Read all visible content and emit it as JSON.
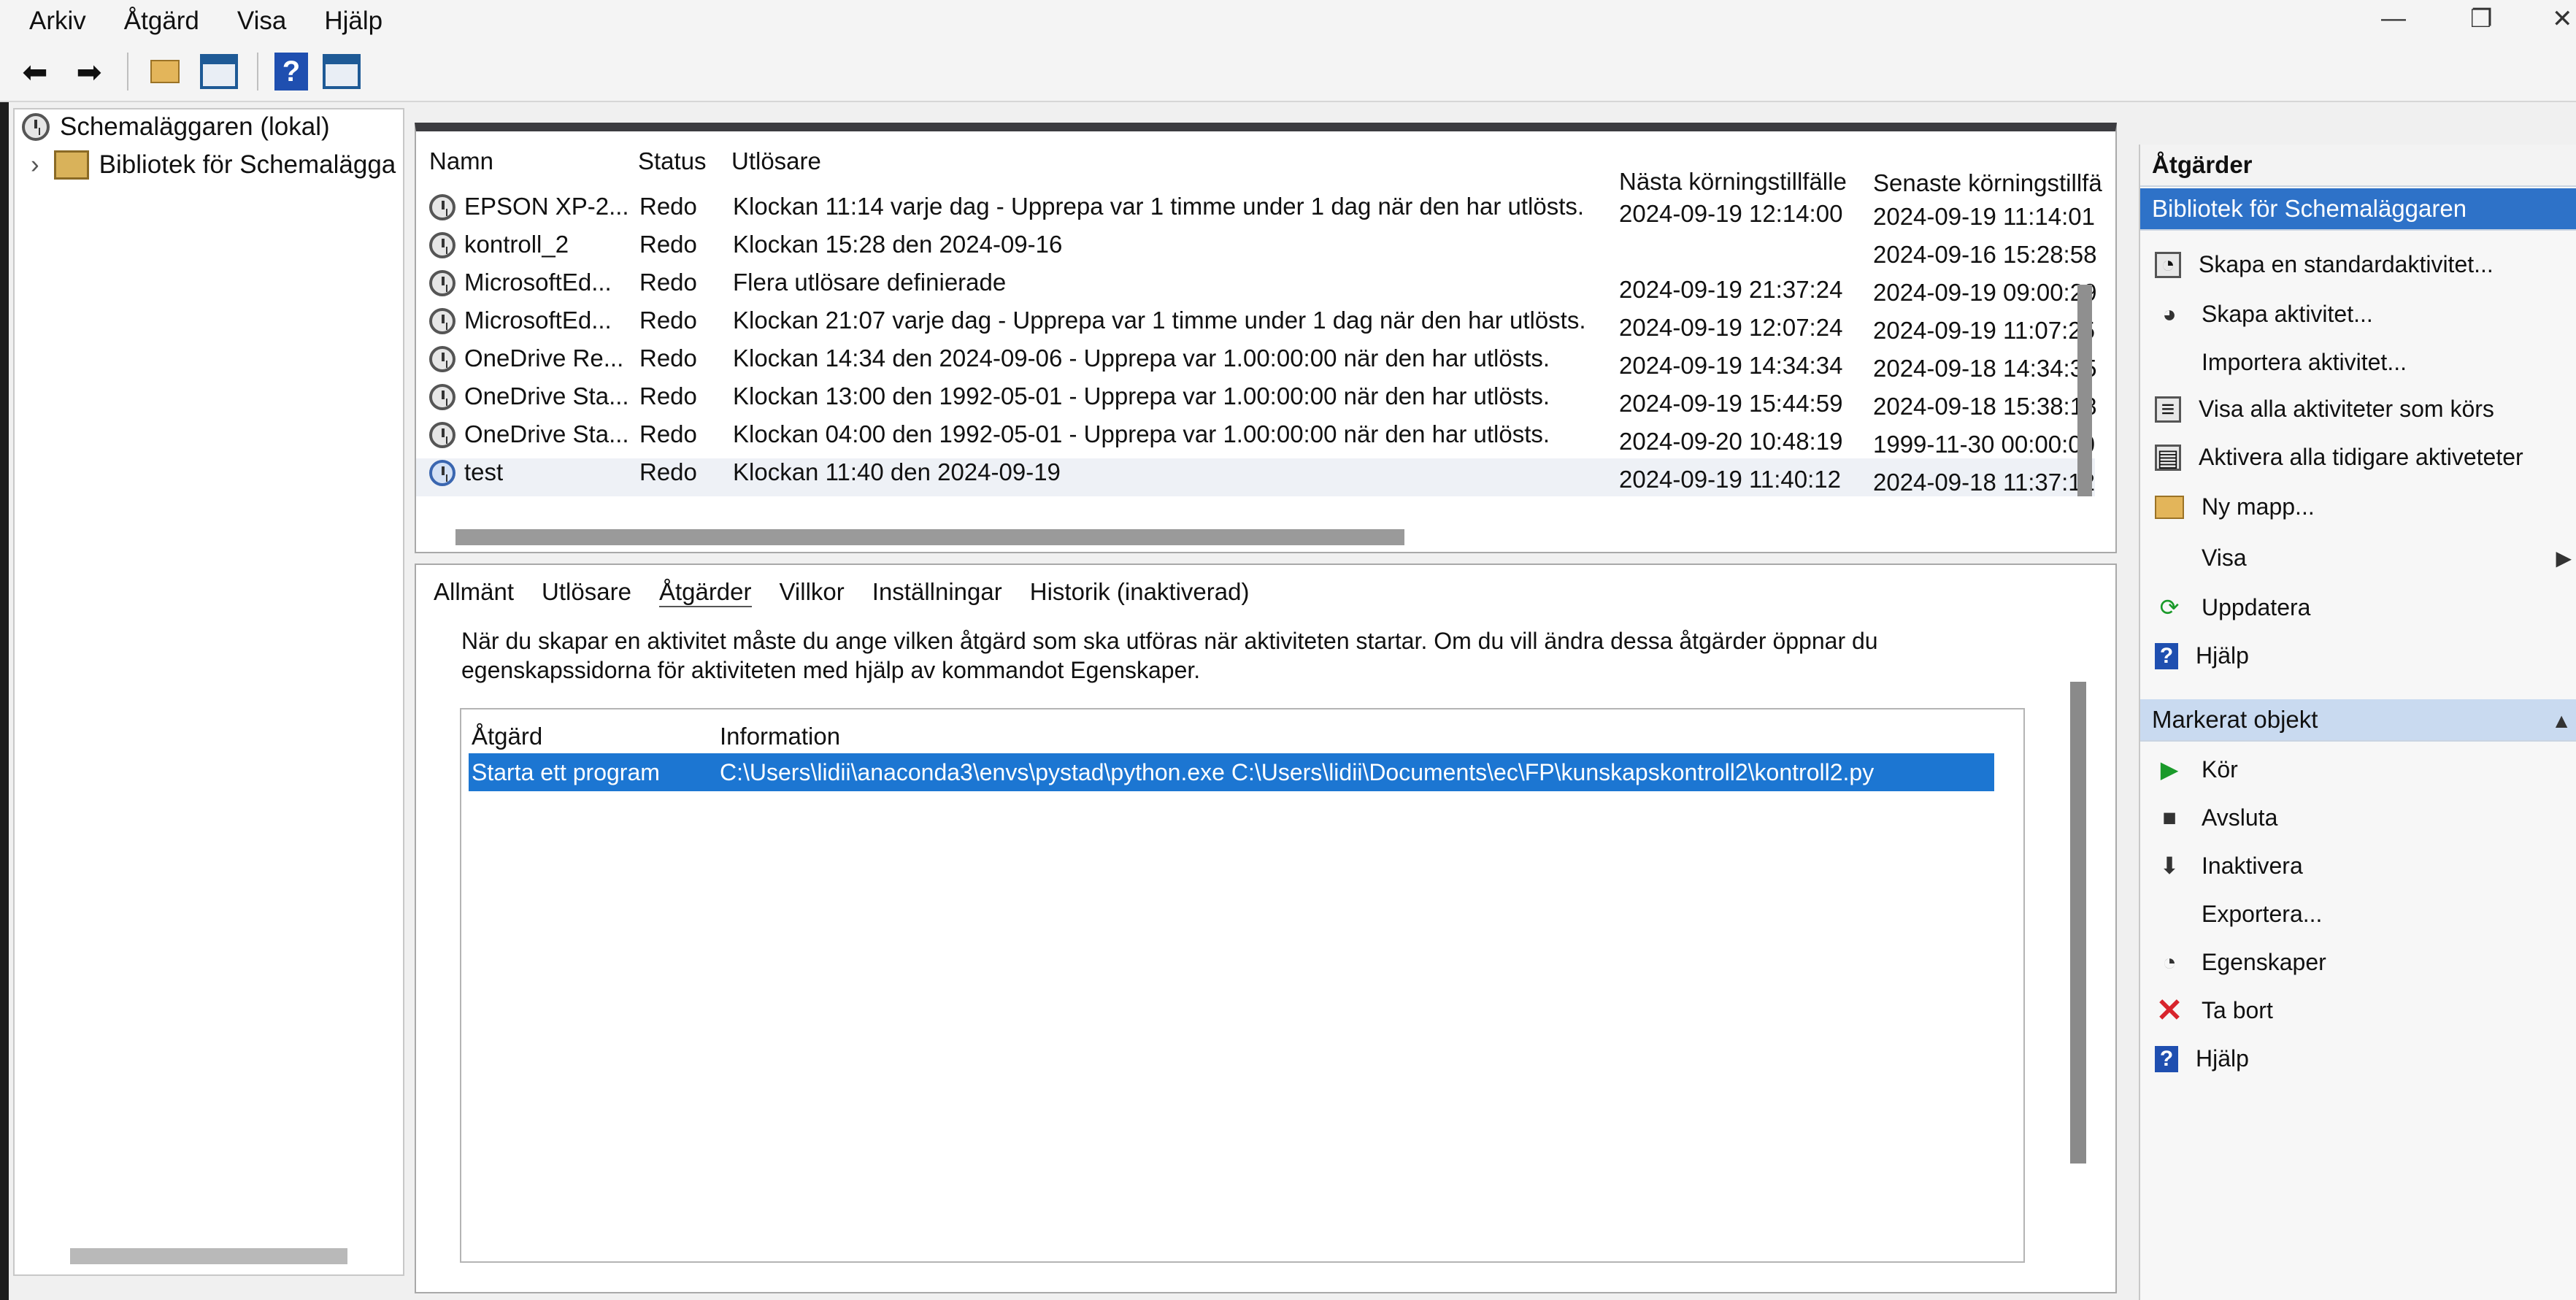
{
  "menu": [
    "Arkiv",
    "Åtgärd",
    "Visa",
    "Hjälp"
  ],
  "toolbar": {
    "back_icon": "arrow-left-icon",
    "forward_icon": "arrow-right-icon",
    "help_label": "?"
  },
  "tree": {
    "root": "Schemaläggaren (lokal)",
    "expander": "›",
    "child": "Bibliotek för Schemalägga"
  },
  "list": {
    "columns": [
      "Namn",
      "Status",
      "Utlösare",
      "Nästa körningstillfälle",
      "Senaste körningstillfä"
    ],
    "rows": [
      {
        "name": "EPSON XP-2...",
        "status": "Redo",
        "trigger": "Klockan 11:14 varje dag - Upprepa var 1 timme under 1 dag när den har utlösts.",
        "next": "2024-09-19 12:14:00",
        "last": "2024-09-19 11:14:01"
      },
      {
        "name": "kontroll_2",
        "status": "Redo",
        "trigger": "Klockan 15:28 den 2024-09-16",
        "next": "",
        "last": "2024-09-16 15:28:58"
      },
      {
        "name": "MicrosoftEd...",
        "status": "Redo",
        "trigger": "Flera utlösare definierade",
        "next": "2024-09-19 21:37:24",
        "last": "2024-09-19 09:00:29"
      },
      {
        "name": "MicrosoftEd...",
        "status": "Redo",
        "trigger": "Klockan 21:07 varje dag - Upprepa var 1 timme under 1 dag när den har utlösts.",
        "next": "2024-09-19 12:07:24",
        "last": "2024-09-19 11:07:25"
      },
      {
        "name": "OneDrive Re...",
        "status": "Redo",
        "trigger": "Klockan 14:34 den 2024-09-06 - Upprepa var 1.00:00:00 när den har utlösts.",
        "next": "2024-09-19 14:34:34",
        "last": "2024-09-18 14:34:35"
      },
      {
        "name": "OneDrive Sta...",
        "status": "Redo",
        "trigger": "Klockan 13:00 den 1992-05-01 - Upprepa var 1.00:00:00 när den har utlösts.",
        "next": "2024-09-19 15:44:59",
        "last": "2024-09-18 15:38:18"
      },
      {
        "name": "OneDrive Sta...",
        "status": "Redo",
        "trigger": "Klockan 04:00 den 1992-05-01 - Upprepa var 1.00:00:00 när den har utlösts.",
        "next": "2024-09-20 10:48:19",
        "last": "1999-11-30 00:00:00"
      },
      {
        "name": "test",
        "status": "Redo",
        "trigger": "Klockan 11:40 den 2024-09-19",
        "next": "2024-09-19 11:40:12",
        "last": "2024-09-18 11:37:12"
      }
    ]
  },
  "details": {
    "tabs": [
      "Allmänt",
      "Utlösare",
      "Åtgärder",
      "Villkor",
      "Inställningar",
      "Historik (inaktiverad)"
    ],
    "active_tab": "Åtgärder",
    "description": "När du skapar en aktivitet måste du ange vilken åtgärd som ska utföras när aktiviteten startar. Om du vill ändra dessa åtgärder öppnar du egenskapssidorna för aktiviteten med hjälp av kommandot Egenskaper.",
    "columns": [
      "Åtgärd",
      "Information"
    ],
    "row": {
      "action": "Starta ett program",
      "info": "C:\\Users\\lidii\\anaconda3\\envs\\pystad\\python.exe C:\\Users\\lidii\\Documents\\ec\\FP\\kunskapskontroll2\\kontroll2.py"
    }
  },
  "actions_pane": {
    "title": "Åtgärder",
    "section1": "Bibliotek för Schemaläggaren",
    "items1": [
      {
        "label": "Skapa en standardaktivitet...",
        "icon": "create-basic-task-icon"
      },
      {
        "label": "Skapa aktivitet...",
        "icon": "create-task-icon"
      },
      {
        "label": "Importera aktivitet...",
        "icon": ""
      },
      {
        "label": "Visa alla aktiviteter som körs",
        "icon": "running-tasks-icon"
      },
      {
        "label": "Aktivera alla tidigare aktiveteter",
        "icon": "history-icon"
      },
      {
        "label": "Ny mapp...",
        "icon": "folder-icon"
      },
      {
        "label": "Visa",
        "icon": ""
      },
      {
        "label": "Uppdatera",
        "icon": "refresh-icon"
      },
      {
        "label": "Hjälp",
        "icon": "help-icon"
      }
    ],
    "section2": "Markerat objekt",
    "items2": [
      {
        "label": "Kör",
        "icon": "run-icon"
      },
      {
        "label": "Avsluta",
        "icon": "stop-icon"
      },
      {
        "label": "Inaktivera",
        "icon": "disable-icon"
      },
      {
        "label": "Exportera...",
        "icon": ""
      },
      {
        "label": "Egenskaper",
        "icon": "properties-icon"
      },
      {
        "label": "Ta bort",
        "icon": "delete-icon"
      },
      {
        "label": "Hjälp",
        "icon": "help-icon"
      }
    ]
  },
  "colors": {
    "selection": "#1c76d2",
    "section_selected": "#2e72c8",
    "section_header": "#c9daf0"
  }
}
